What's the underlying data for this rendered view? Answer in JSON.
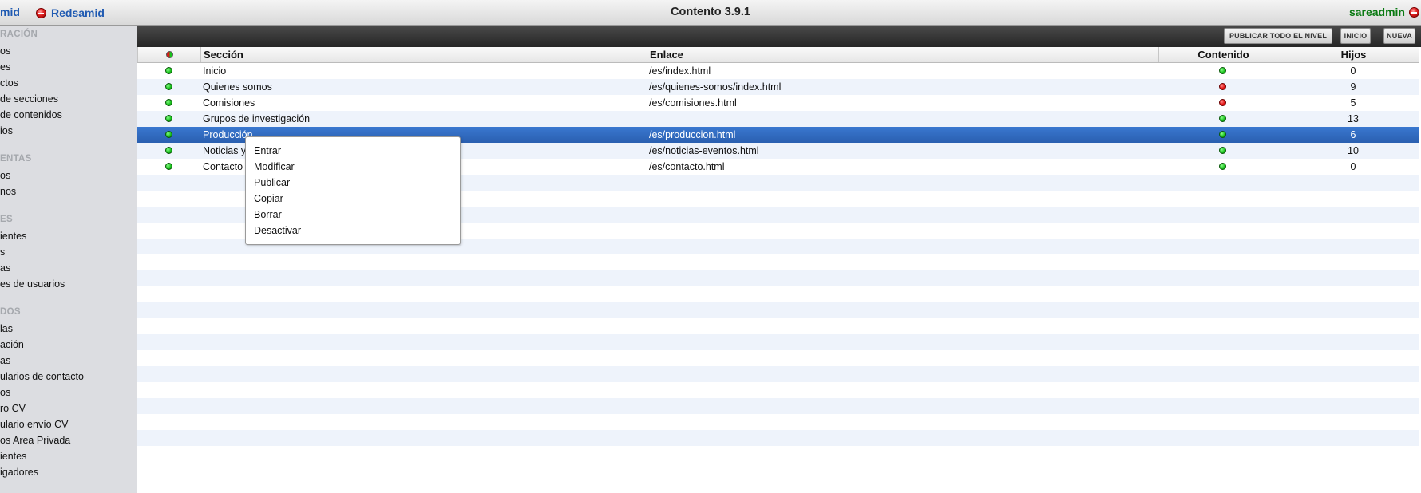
{
  "topbar": {
    "brand_left": "mid",
    "site_name": "Redsamid",
    "app_title": "Contento 3.9.1",
    "user_name": "sareadmin"
  },
  "sidebar": {
    "sections": [
      {
        "label": "RACIÓN",
        "items": [
          "os",
          "es",
          "ctos",
          "de secciones",
          "de contenidos",
          "ios"
        ]
      },
      {
        "label": "ENTAS",
        "items": [
          "os",
          "nos"
        ]
      },
      {
        "label": "ES",
        "items": [
          "ientes",
          "s",
          "as",
          "es de usuarios"
        ]
      },
      {
        "label": "DOS",
        "items": [
          "las",
          "ación",
          "as",
          "ularios de contacto",
          "os",
          "ro CV",
          "ulario envío CV",
          "os Area Privada",
          "ientes",
          "igadores"
        ]
      }
    ]
  },
  "toolbar": {
    "publish_all": "PUBLICAR TODO EL NIVEL",
    "home": "INICIO",
    "new": "NUEVA"
  },
  "table": {
    "headers": {
      "section": "Sección",
      "link": "Enlace",
      "content": "Contenido",
      "children": "Hijos"
    },
    "rows": [
      {
        "status": "green",
        "section": "Inicio",
        "link": "/es/index.html",
        "content": "green",
        "children": "0"
      },
      {
        "status": "green",
        "section": "Quienes somos",
        "link": "/es/quienes-somos/index.html",
        "content": "red",
        "children": "9"
      },
      {
        "status": "green",
        "section": "Comisiones",
        "link": "/es/comisiones.html",
        "content": "red",
        "children": "5"
      },
      {
        "status": "green",
        "section": "Grupos de investigación",
        "link": "",
        "content": "green",
        "children": "13"
      },
      {
        "status": "green",
        "section": "Producción",
        "link": "/es/produccion.html",
        "content": "green",
        "children": "6",
        "selected": true
      },
      {
        "status": "green",
        "section": "Noticias y",
        "link": "/es/noticias-eventos.html",
        "content": "green",
        "children": "10"
      },
      {
        "status": "green",
        "section": "Contacto",
        "link": "/es/contacto.html",
        "content": "green",
        "children": "0"
      }
    ]
  },
  "context_menu": {
    "items": [
      "Entrar",
      "Modificar",
      "Publicar",
      "Copiar",
      "Borrar",
      "Desactivar"
    ]
  },
  "colors": {
    "accent_blue": "#2a5fb0",
    "status_green": "#19c21c",
    "status_red": "#e01010",
    "row_stripe": "#eef3fb",
    "sidebar_bg": "#dcdde1"
  }
}
